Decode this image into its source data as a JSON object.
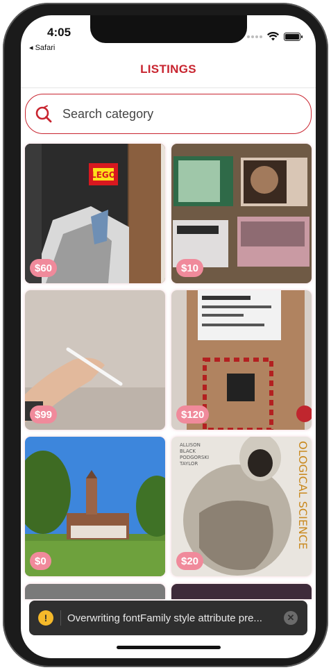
{
  "status_bar": {
    "time": "4:05",
    "back_label": "◂ Safari"
  },
  "header": {
    "title": "LISTINGS"
  },
  "search": {
    "placeholder": "Search category"
  },
  "listings": [
    {
      "price": "$60",
      "image": "lego-box"
    },
    {
      "price": "$10",
      "image": "posters"
    },
    {
      "price": "$99",
      "image": "apple-pencil"
    },
    {
      "price": "$120",
      "image": "cardboard-box"
    },
    {
      "price": "$0",
      "image": "campus-building"
    },
    {
      "price": "$20",
      "image": "biology-textbook"
    }
  ],
  "toast": {
    "message": "Overwriting fontFamily style attribute pre...",
    "icon": "warning-icon"
  },
  "colors": {
    "accent": "#c8242f",
    "price_badge": "#f08a9b",
    "toast_bg": "#2f2f2f"
  }
}
